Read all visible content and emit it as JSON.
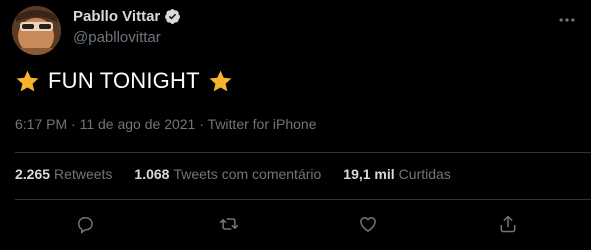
{
  "author": {
    "display_name": "Pabllo Vittar",
    "handle": "@pabllovittar",
    "verified": true
  },
  "tweet": {
    "text": "FUN TONIGHT",
    "leading_emoji": "star",
    "trailing_emoji": "star"
  },
  "meta": {
    "time": "6:17 PM",
    "date": "11 de ago de 2021",
    "separator": "·",
    "source": "Twitter for iPhone"
  },
  "stats": {
    "retweets_count": "2.265",
    "retweets_label": "Retweets",
    "quotes_count": "1.068",
    "quotes_label": "Tweets com comentário",
    "likes_count": "19,1 mil",
    "likes_label": "Curtidas"
  },
  "actions": [
    "reply-icon",
    "retweet-icon",
    "like-icon",
    "share-icon"
  ],
  "colors": {
    "background": "#000000",
    "text": "#d9d9d9",
    "muted": "#6e767d",
    "divider": "#2f3336",
    "verified": "#d9d9d9",
    "star": "#f7b32b"
  }
}
